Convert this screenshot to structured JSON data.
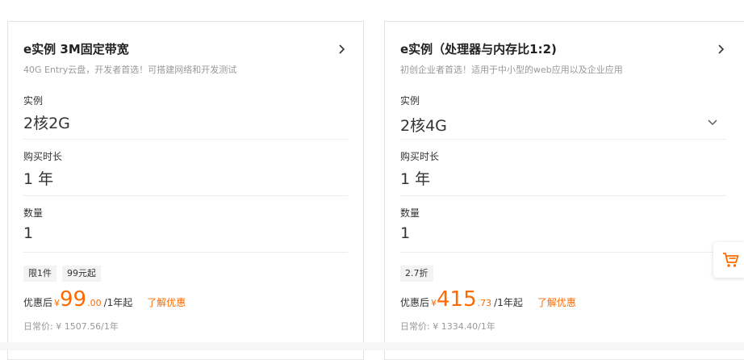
{
  "cards": [
    {
      "title": "e实例 3M固定带宽",
      "subtitle": "40G Entry云盘，开发者首选！可搭建网络和开发测试",
      "instance_label": "实例",
      "instance_value": "2核2G",
      "duration_label": "购买时长",
      "duration_value": "1 年",
      "quantity_label": "数量",
      "quantity_value": "1",
      "tags": [
        "限1件",
        "99元起"
      ],
      "price_label": "优惠后",
      "currency": "¥",
      "price_int": "99",
      "price_dec": ".00",
      "price_unit": "/1年起",
      "promo_link": "了解优惠",
      "regular_price": "日常价: ¥ 1507.56/1年"
    },
    {
      "title": "e实例（处理器与内存比1:2)",
      "subtitle": "初创企业者首选！适用于中小型的web应用以及企业应用",
      "instance_label": "实例",
      "instance_value": "2核4G",
      "duration_label": "购买时长",
      "duration_value": "1 年",
      "quantity_label": "数量",
      "quantity_value": "1",
      "tags": [
        "2.7折"
      ],
      "price_label": "优惠后",
      "currency": "¥",
      "price_int": "415",
      "price_dec": ".73",
      "price_unit": "/1年起",
      "promo_link": "了解优惠",
      "regular_price": "日常价: ¥ 1334.40/1年"
    }
  ],
  "icons": {
    "card_nav": "chevron-right-icon",
    "instance_dropdown": "chevron-down-icon",
    "cart": "shopping-cart-icon"
  },
  "colors": {
    "accent": "#ff6a00",
    "tag_bg": "#f3f3f3",
    "muted_text": "#999999"
  }
}
